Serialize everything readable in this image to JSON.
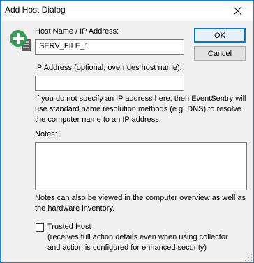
{
  "window": {
    "title": "Add Host Dialog",
    "close_icon": "close-icon",
    "accent": "#1883d7"
  },
  "host": {
    "icon": "add-server-icon",
    "name_label": "Host Name / IP Address:",
    "name_value": "SERV_FILE_1",
    "ip_label": "IP Address (optional, overrides host name):",
    "ip_value": "",
    "ip_help": "If you do not specify an IP address here, then EventSentry will use standard name resolution methods (e.g. DNS) to resolve the computer name to an IP address."
  },
  "notes": {
    "label": "Notes:",
    "value": "",
    "help": "Notes can also be viewed in the computer overview as well as the hardware inventory."
  },
  "trusted": {
    "label": "Trusted Host",
    "checked": false,
    "description": "(receives full action details even when using collector and action is configured for enhanced security)"
  },
  "buttons": {
    "ok": "OK",
    "cancel": "Cancel"
  }
}
